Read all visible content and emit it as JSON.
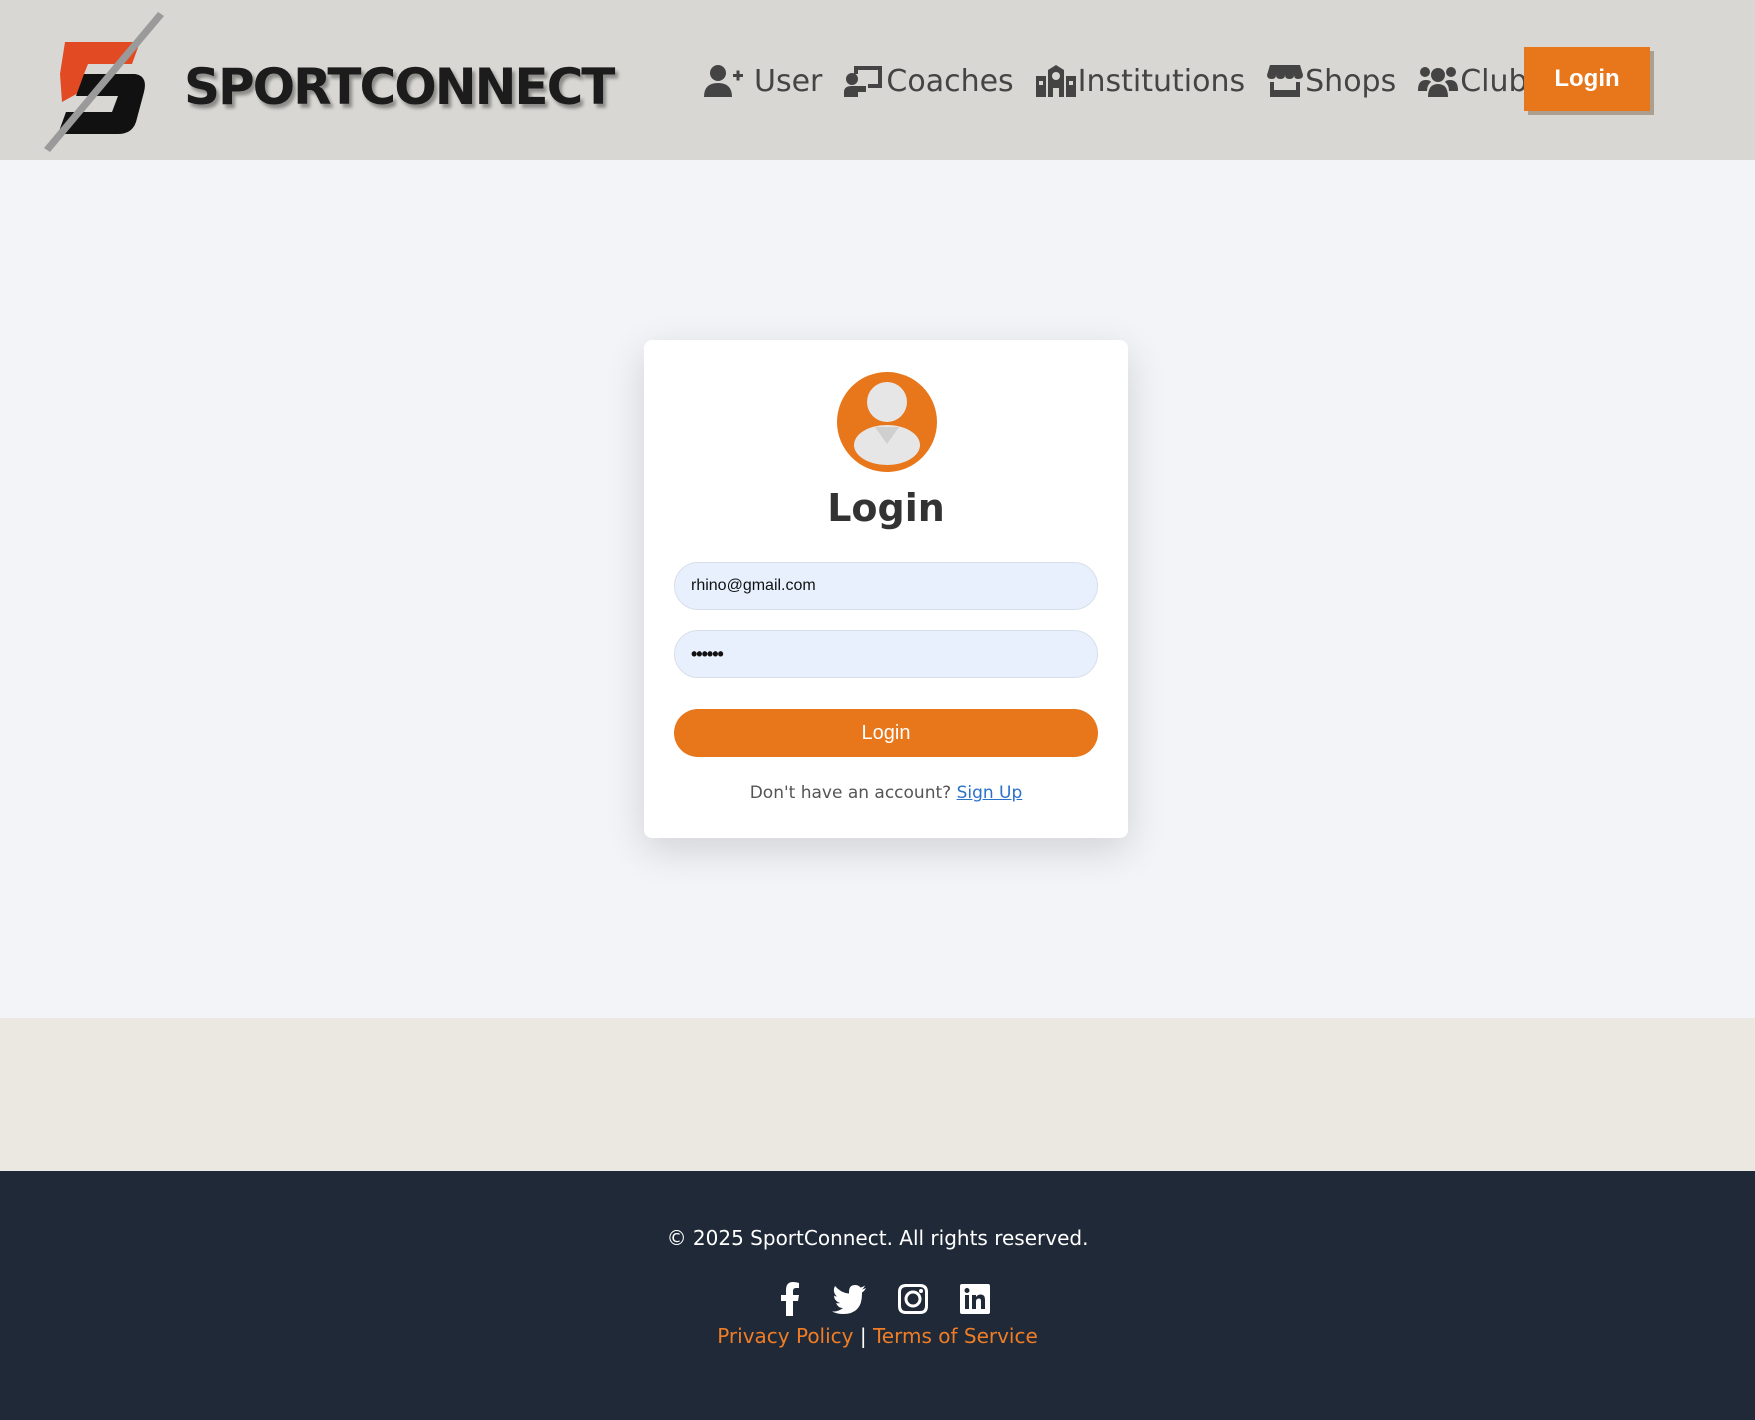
{
  "header": {
    "logo_text": "SPORTCONNECT",
    "nav": [
      {
        "label": "User",
        "icon": "user-plus-icon"
      },
      {
        "label": "Coaches",
        "icon": "chalkboard-teacher-icon"
      },
      {
        "label": "Institutions",
        "icon": "school-icon"
      },
      {
        "label": "Shops",
        "icon": "store-icon"
      },
      {
        "label": "Clubs",
        "icon": "users-icon"
      }
    ],
    "login_button": "Login"
  },
  "login_card": {
    "title": "Login",
    "email_value": "rhino@gmail.com",
    "password_mask": "••••••",
    "submit_label": "Login",
    "signup_prompt": "Don't have an account?",
    "signup_link": "Sign Up"
  },
  "footer": {
    "copyright": "© 2025 SportConnect. All rights reserved.",
    "social_icons": [
      "facebook-icon",
      "twitter-icon",
      "instagram-icon",
      "linkedin-icon"
    ],
    "privacy_link": "Privacy Policy",
    "separator": "|",
    "terms_link": "Terms of Service"
  },
  "colors": {
    "accent": "#e8761b",
    "header_bg": "#d8d7d3",
    "footer_bg": "#1f2937",
    "link_blue": "#2a72c8"
  }
}
